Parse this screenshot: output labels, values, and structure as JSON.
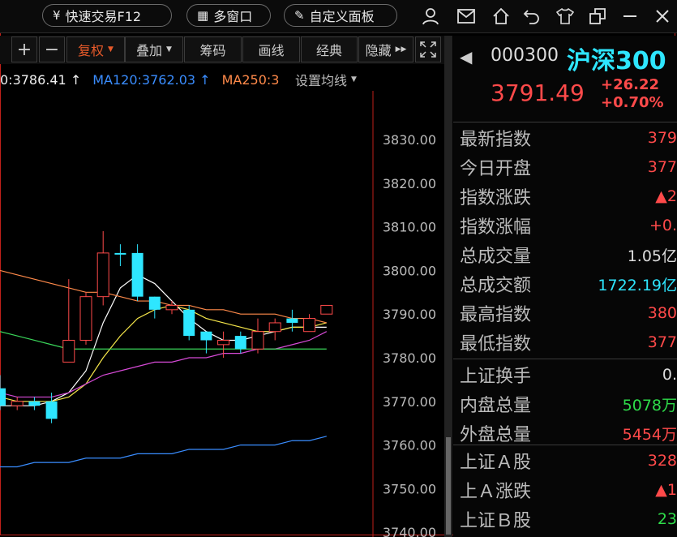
{
  "topbar": {
    "quick_trade": {
      "icon": "yuan-icon",
      "label": "快速交易F12"
    },
    "multi_window": {
      "icon": "grid-icon",
      "label": "多窗口"
    },
    "custom_panel": {
      "icon": "edit-panel-icon",
      "label": "自定义面板"
    }
  },
  "toolbar": {
    "plus": "+",
    "minus": "−",
    "fuquan": "复权",
    "diejia": "叠加",
    "chouma": "筹码",
    "huaxian": "画线",
    "jingdian": "经典",
    "yincang": "隐藏"
  },
  "ma_line": {
    "ma60": "0:3786.41 ↑",
    "ma120": "MA120:3762.03 ↑",
    "ma250": "MA250:3",
    "setting": "设置均线"
  },
  "colors": {
    "up": "#ff4a4a",
    "down": "#2ee6ff",
    "ma_blue": "#3a8dff",
    "ma_orange": "#ff8a4a",
    "toolbar_active": "#e85a2a",
    "green": "#2edc4a"
  },
  "chart_data": {
    "type": "candlestick",
    "ylim": [
      3740,
      3840
    ],
    "y_ticks": [
      "3830.00",
      "3820.00",
      "3810.00",
      "3800.00",
      "3790.00",
      "3780.00",
      "3770.00",
      "3760.00",
      "3750.00",
      "3740.00"
    ],
    "candles": [
      {
        "o": 3769,
        "c": 3773,
        "h": 3776,
        "l": 3768,
        "dir": "down"
      },
      {
        "o": 3769,
        "c": 3770,
        "h": 3771,
        "l": 3768,
        "dir": "up"
      },
      {
        "o": 3770,
        "c": 3769,
        "h": 3771,
        "l": 3768,
        "dir": "down"
      },
      {
        "o": 3770,
        "c": 3766,
        "h": 3772,
        "l": 3765,
        "dir": "down"
      },
      {
        "o": 3779,
        "c": 3784,
        "h": 3798,
        "l": 3779,
        "dir": "up"
      },
      {
        "o": 3784,
        "c": 3794,
        "h": 3795,
        "l": 3783,
        "dir": "up"
      },
      {
        "o": 3794,
        "c": 3804,
        "h": 3809,
        "l": 3792,
        "dir": "up"
      },
      {
        "o": 3804,
        "c": 3804,
        "h": 3806,
        "l": 3801,
        "dir": "down"
      },
      {
        "o": 3804,
        "c": 3794,
        "h": 3806,
        "l": 3793,
        "dir": "down"
      },
      {
        "o": 3794,
        "c": 3791,
        "h": 3794,
        "l": 3789,
        "dir": "down"
      },
      {
        "o": 3791,
        "c": 3792,
        "h": 3793,
        "l": 3790,
        "dir": "up"
      },
      {
        "o": 3791,
        "c": 3785,
        "h": 3792,
        "l": 3784,
        "dir": "down"
      },
      {
        "o": 3786,
        "c": 3784,
        "h": 3786,
        "l": 3781,
        "dir": "down"
      },
      {
        "o": 3783,
        "c": 3784,
        "h": 3786,
        "l": 3780,
        "dir": "up"
      },
      {
        "o": 3785,
        "c": 3782,
        "h": 3786,
        "l": 3781,
        "dir": "down"
      },
      {
        "o": 3782,
        "c": 3786,
        "h": 3789,
        "l": 3781,
        "dir": "up"
      },
      {
        "o": 3786,
        "c": 3788,
        "h": 3789,
        "l": 3784,
        "dir": "up"
      },
      {
        "o": 3789,
        "c": 3788,
        "h": 3791,
        "l": 3786,
        "dir": "down"
      },
      {
        "o": 3786,
        "c": 3789,
        "h": 3790,
        "l": 3786,
        "dir": "up"
      },
      {
        "o": 3790,
        "c": 3792,
        "h": 3792,
        "l": 3790,
        "dir": "up"
      }
    ],
    "ma_lines": [
      {
        "color": "#ffffff",
        "values": [
          3769,
          3769,
          3769,
          3770,
          3772,
          3777,
          3788,
          3796,
          3799,
          3797,
          3793,
          3789,
          3786,
          3784,
          3784,
          3785,
          3786,
          3787,
          3787,
          3787
        ]
      },
      {
        "color": "#f5e64a",
        "values": [
          3771,
          3770,
          3770,
          3770,
          3771,
          3774,
          3780,
          3785,
          3789,
          3791,
          3792,
          3791,
          3789,
          3788,
          3787,
          3786,
          3786,
          3787,
          3787,
          3788
        ]
      },
      {
        "color": "#d64ad6",
        "values": [
          3772,
          3771,
          3771,
          3771,
          3772,
          3774,
          3776,
          3777,
          3778,
          3779,
          3779,
          3780,
          3780,
          3781,
          3781,
          3782,
          3782,
          3783,
          3784,
          3786
        ]
      },
      {
        "color": "#3ad65a",
        "values": [
          3786,
          3785,
          3784,
          3783,
          3782,
          3782,
          3782,
          3782,
          3782,
          3782,
          3782,
          3782,
          3782,
          3782,
          3782,
          3782,
          3782,
          3782,
          3782,
          3782
        ]
      },
      {
        "color": "#ff8a4a",
        "values": [
          3800,
          3799,
          3798,
          3797,
          3796,
          3795,
          3795,
          3794,
          3793,
          3793,
          3792,
          3792,
          3791,
          3791,
          3790,
          3790,
          3790,
          3789,
          3789,
          3788
        ]
      },
      {
        "color": "#3a8dff",
        "values": [
          3755,
          3755,
          3756,
          3756,
          3756,
          3757,
          3757,
          3757,
          3758,
          3758,
          3758,
          3759,
          3759,
          3759,
          3760,
          3760,
          3760,
          3761,
          3761,
          3762
        ]
      }
    ]
  },
  "quote": {
    "code": "000300",
    "name": "沪深300",
    "price": "3791.49",
    "change": "+26.22",
    "change_pct": "+0.70%"
  },
  "stats": [
    {
      "label": "最新指数",
      "value": "379",
      "color": "#ff4a4a"
    },
    {
      "label": "今日开盘",
      "value": "377",
      "color": "#ff4a4a"
    },
    {
      "label": "指数涨跌",
      "value": "▲2",
      "color": "#ff4a4a"
    },
    {
      "label": "指数涨幅",
      "value": "+0.",
      "color": "#ff4a4a"
    },
    {
      "label": "总成交量",
      "value": "1.05亿",
      "color": "#dddddd"
    },
    {
      "label": "总成交额",
      "value": "1722.19亿",
      "color": "#2ee6ff"
    },
    {
      "label": "最高指数",
      "value": "380",
      "color": "#ff4a4a"
    },
    {
      "label": "最低指数",
      "value": "377",
      "color": "#ff4a4a"
    }
  ],
  "stats2": [
    {
      "label": "上证换手",
      "value": "0.",
      "color": "#dddddd"
    },
    {
      "label": "内盘总量",
      "value": "5078万",
      "color": "#2edc4a"
    },
    {
      "label": "外盘总量",
      "value": "5454万",
      "color": "#ff4a4a"
    }
  ],
  "stats3": [
    {
      "label": "上证Ａ股",
      "value": "328",
      "color": "#ff4a4a"
    },
    {
      "label": "上Ａ涨跌",
      "value": "▲1",
      "color": "#ff4a4a"
    },
    {
      "label": "上证Ｂ股",
      "value": "23",
      "color": "#2edc4a"
    }
  ]
}
